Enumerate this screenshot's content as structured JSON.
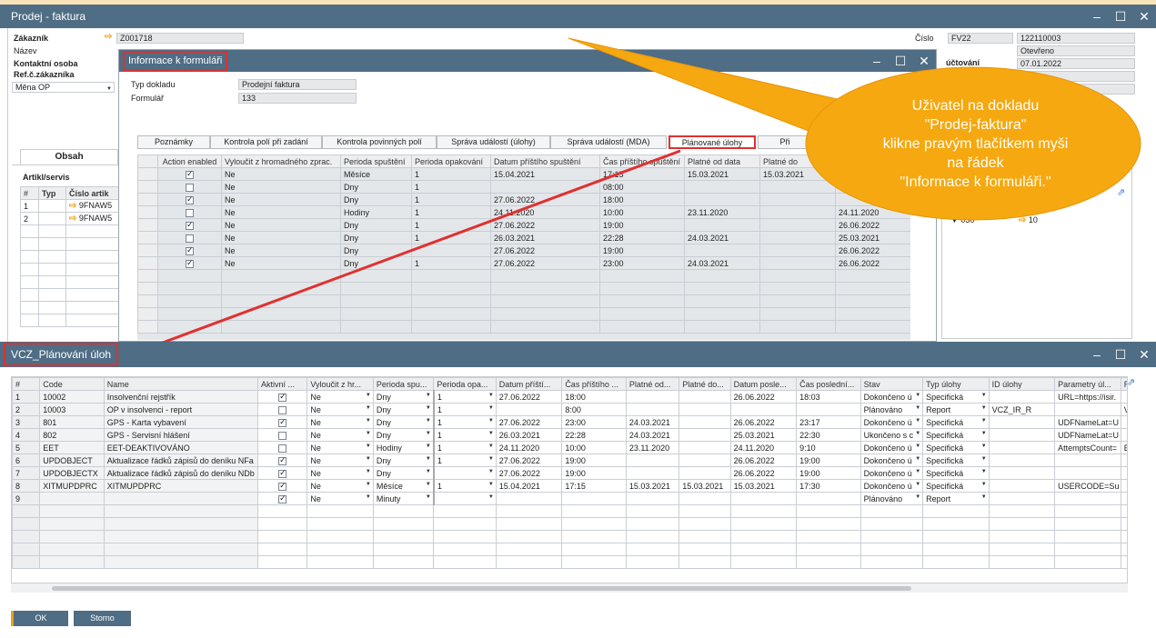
{
  "main_window": {
    "title": "Prodej - faktura"
  },
  "header": {
    "customer_label": "Zákazník",
    "customer_value": "Z001718",
    "name_label": "Název",
    "contact_label": "Kontaktní osoba",
    "ref_label": "Ref.č.zákazníka",
    "currency_value": "Měna OP",
    "number_label": "Číslo",
    "series_value": "FV22",
    "number_value": "122110003",
    "status_value": "Otevřeno",
    "posting_label": "účtování",
    "posting_value": "07.01.2022"
  },
  "bg_tabs": {
    "contents": "Obsah"
  },
  "bg_items": {
    "label": "Artikl/servis",
    "cols": [
      "#",
      "Typ",
      "Číslo artik"
    ],
    "rows": [
      {
        "n": "1",
        "code": "9FNAW5"
      },
      {
        "n": "2",
        "code": "9FNAW5"
      }
    ]
  },
  "bg_right": {
    "a": "030",
    "b": "10"
  },
  "form_info": {
    "title": "Informace k formuláři",
    "doc_type_label": "Typ dokladu",
    "doc_type_value": "Prodejní faktura",
    "form_label": "Formulář",
    "form_value": "133",
    "tabs": [
      "Poznámky",
      "Kontrola polí při zadání",
      "Kontrola povinných polí",
      "Správa událostí (úlohy)",
      "Správa událostí (MDA)",
      "Plánované úlohy",
      "Při"
    ],
    "columns": [
      "Action enabled",
      "Vyloučit z hromadného zprac.",
      "Perioda spuštění",
      "Perioda opakování",
      "Datum příštího spuštění",
      "Čas příštího spuštění",
      "Platné od data",
      "Platné do"
    ],
    "rows": [
      {
        "enabled": true,
        "excl": "Ne",
        "period": "Měsíce",
        "rep": "1",
        "date": "15.04.2021",
        "time": "17:15",
        "from": "15.03.2021",
        "to": "15.03.2021",
        "last": ""
      },
      {
        "enabled": false,
        "excl": "Ne",
        "period": "Dny",
        "rep": "1",
        "date": "",
        "time": "08:00",
        "from": "",
        "to": "",
        "last": ""
      },
      {
        "enabled": true,
        "excl": "Ne",
        "period": "Dny",
        "rep": "1",
        "date": "27.06.2022",
        "time": "18:00",
        "from": "",
        "to": "",
        "last": ""
      },
      {
        "enabled": false,
        "excl": "Ne",
        "period": "Hodiny",
        "rep": "1",
        "date": "24.11.2020",
        "time": "10:00",
        "from": "23.11.2020",
        "to": "",
        "last": "24.11.2020"
      },
      {
        "enabled": true,
        "excl": "Ne",
        "period": "Dny",
        "rep": "1",
        "date": "27.06.2022",
        "time": "19:00",
        "from": "",
        "to": "",
        "last": "26.06.2022"
      },
      {
        "enabled": false,
        "excl": "Ne",
        "period": "Dny",
        "rep": "1",
        "date": "26.03.2021",
        "time": "22:28",
        "from": "24.03.2021",
        "to": "",
        "last": "25.03.2021"
      },
      {
        "enabled": true,
        "excl": "Ne",
        "period": "Dny",
        "rep": "",
        "date": "27.06.2022",
        "time": "19:00",
        "from": "",
        "to": "",
        "last": "26.06.2022"
      },
      {
        "enabled": true,
        "excl": "Ne",
        "period": "Dny",
        "rep": "1",
        "date": "27.06.2022",
        "time": "23:00",
        "from": "24.03.2021",
        "to": "",
        "last": "26.06.2022"
      }
    ]
  },
  "callout": {
    "text": "Uživatel na dokladu\n\"Prodej-faktura\"\nklikne pravým tlačítkem myši\nna řádek\n\"Informace k formuláři.\""
  },
  "scheduler": {
    "title": "VCZ_Plánování úloh",
    "columns": [
      "#",
      "Code",
      "Name",
      "Aktivní ...",
      "Vyloučit z hr...",
      "Perioda spu...",
      "Perioda opa...",
      "Datum příští...",
      "Čas příštího ...",
      "Platné od...",
      "Platné do...",
      "Datum posle...",
      "Čas poslední...",
      "Stav",
      "Typ úlohy",
      "ID úlohy",
      "Parametry úl...",
      "R"
    ],
    "rows": [
      {
        "n": "1",
        "code": "10002",
        "name": "Insolvenční rejstřík",
        "active": true,
        "excl": "Ne",
        "period": "Dny",
        "rep": "1",
        "next_date": "27.06.2022",
        "next_time": "18:00",
        "from": "",
        "to": "",
        "last_date": "26.06.2022",
        "last_time": "18:03",
        "state": "Dokončeno ú",
        "type": "Specifická",
        "id": "",
        "params": "URL=https://isir.",
        "r": ""
      },
      {
        "n": "2",
        "code": "10003",
        "name": "OP v insolvenci - report",
        "active": false,
        "excl": "Ne",
        "period": "Dny",
        "rep": "1",
        "next_date": "",
        "next_time": "8:00",
        "from": "",
        "to": "",
        "last_date": "",
        "last_time": "",
        "state": "Plánováno",
        "type": "Report",
        "id": "VCZ_IR_R",
        "params": "",
        "r": "VC"
      },
      {
        "n": "3",
        "code": "801",
        "name": "GPS - Karta vybavení",
        "active": true,
        "excl": "Ne",
        "period": "Dny",
        "rep": "1",
        "next_date": "27.06.2022",
        "next_time": "23:00",
        "from": "24.03.2021",
        "to": "",
        "last_date": "26.06.2022",
        "last_time": "23:17",
        "state": "Dokončeno ú",
        "type": "Specifická",
        "id": "",
        "params": "UDFNameLat=U",
        "r": ""
      },
      {
        "n": "4",
        "code": "802",
        "name": "GPS - Servisní hlášení",
        "active": false,
        "excl": "Ne",
        "period": "Dny",
        "rep": "1",
        "next_date": "26.03.2021",
        "next_time": "22:28",
        "from": "24.03.2021",
        "to": "",
        "last_date": "25.03.2021",
        "last_time": "22:30",
        "state": "Ukončeno s c",
        "type": "Specifická",
        "id": "",
        "params": "UDFNameLat=U",
        "r": ""
      },
      {
        "n": "5",
        "code": "EET",
        "name": "EET-DEAKTIVOVÁNO",
        "active": false,
        "excl": "Ne",
        "period": "Hodiny",
        "rep": "1",
        "next_date": "24.11.2020",
        "next_time": "10:00",
        "from": "23.11.2020",
        "to": "",
        "last_date": "24.11.2020",
        "last_time": "9:10",
        "state": "Dokončeno ú",
        "type": "Specifická",
        "id": "",
        "params": "AttemptsCount=",
        "r": "EET"
      },
      {
        "n": "6",
        "code": "UPDOBJECT",
        "name": "Aktualizace řádků zápisů do deníku NFa",
        "active": true,
        "excl": "Ne",
        "period": "Dny",
        "rep": "1",
        "next_date": "27.06.2022",
        "next_time": "19:00",
        "from": "",
        "to": "",
        "last_date": "26.06.2022",
        "last_time": "19:00",
        "state": "Dokončeno ú",
        "type": "Specifická",
        "id": "",
        "params": "",
        "r": ""
      },
      {
        "n": "7",
        "code": "UPDOBJECTX",
        "name": "Aktualizace řádků zápisů do deníku NDb",
        "active": true,
        "excl": "Ne",
        "period": "Dny",
        "rep": "",
        "next_date": "27.06.2022",
        "next_time": "19:00",
        "from": "",
        "to": "",
        "last_date": "26.06.2022",
        "last_time": "19:00",
        "state": "Dokončeno ú",
        "type": "Specifická",
        "id": "",
        "params": "",
        "r": ""
      },
      {
        "n": "8",
        "code": "XITMUPDPRC",
        "name": "XITMUPDPRC",
        "active": true,
        "excl": "Ne",
        "period": "Měsíce",
        "rep": "1",
        "next_date": "15.04.2021",
        "next_time": "17:15",
        "from": "15.03.2021",
        "to": "15.03.2021",
        "last_date": "15.03.2021",
        "last_time": "17:30",
        "state": "Dokončeno ú",
        "type": "Specifická",
        "id": "",
        "params": "USERCODE=Su",
        "r": ""
      },
      {
        "n": "9",
        "code": "",
        "name": "",
        "active": true,
        "excl": "Ne",
        "period": "Minuty",
        "rep": "",
        "next_date": "",
        "next_time": "",
        "from": "",
        "to": "",
        "last_date": "",
        "last_time": "",
        "state": "Plánováno",
        "type": "Report",
        "id": "",
        "params": "",
        "r": ""
      }
    ],
    "ok_label": "OK",
    "cancel_label": "Storno"
  },
  "colors": {
    "titlebar": "#4f6d84",
    "callout": "#f5a810",
    "highlight": "#e03030"
  }
}
